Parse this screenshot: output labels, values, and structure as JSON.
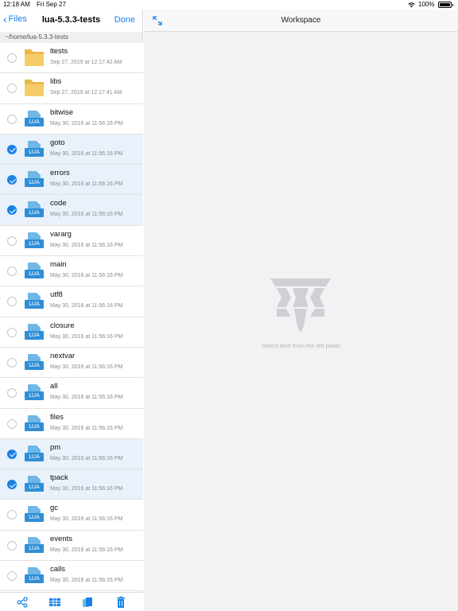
{
  "status": {
    "time": "12:18 AM",
    "date": "Fri Sep 27",
    "battery": "100%"
  },
  "left_nav": {
    "back_label": "Files",
    "title": "lua-5.3.3-tests",
    "done_label": "Done"
  },
  "path": "~/home/lua-5.3.3-tests",
  "files": [
    {
      "name": "ltests",
      "date": "Sep 27, 2019 at 12:17:42 AM",
      "type": "folder",
      "selected": false
    },
    {
      "name": "libs",
      "date": "Sep 27, 2019 at 12:17:41 AM",
      "type": "folder",
      "selected": false
    },
    {
      "name": "bitwise",
      "date": "May 30, 2016 at 11:56:16 PM",
      "type": "lua",
      "selected": false
    },
    {
      "name": "goto",
      "date": "May 30, 2016 at 11:56:16 PM",
      "type": "lua",
      "selected": true
    },
    {
      "name": "errors",
      "date": "May 30, 2016 at 11:56:16 PM",
      "type": "lua",
      "selected": true
    },
    {
      "name": "code",
      "date": "May 30, 2016 at 11:56:16 PM",
      "type": "lua",
      "selected": true
    },
    {
      "name": "vararg",
      "date": "May 30, 2016 at 11:56:16 PM",
      "type": "lua",
      "selected": false
    },
    {
      "name": "main",
      "date": "May 30, 2016 at 11:56:16 PM",
      "type": "lua",
      "selected": false
    },
    {
      "name": "utf8",
      "date": "May 30, 2016 at 11:56:16 PM",
      "type": "lua",
      "selected": false
    },
    {
      "name": "closure",
      "date": "May 30, 2016 at 11:56:16 PM",
      "type": "lua",
      "selected": false
    },
    {
      "name": "nextvar",
      "date": "May 30, 2016 at 11:56:16 PM",
      "type": "lua",
      "selected": false
    },
    {
      "name": "all",
      "date": "May 30, 2016 at 11:56:16 PM",
      "type": "lua",
      "selected": false
    },
    {
      "name": "files",
      "date": "May 30, 2016 at 11:56:16 PM",
      "type": "lua",
      "selected": false
    },
    {
      "name": "pm",
      "date": "May 30, 2016 at 11:56:16 PM",
      "type": "lua",
      "selected": true
    },
    {
      "name": "tpack",
      "date": "May 30, 2016 at 11:56:16 PM",
      "type": "lua",
      "selected": true
    },
    {
      "name": "gc",
      "date": "May 30, 2016 at 11:56:16 PM",
      "type": "lua",
      "selected": false
    },
    {
      "name": "events",
      "date": "May 30, 2016 at 11:56:16 PM",
      "type": "lua",
      "selected": false
    },
    {
      "name": "calls",
      "date": "May 30, 2016 at 11:56:16 PM",
      "type": "lua",
      "selected": false
    }
  ],
  "file_icon_label": "LUA",
  "toolbar": {
    "icons": [
      "share-icon",
      "columns-icon",
      "copy-icon",
      "trash-icon"
    ]
  },
  "workspace": {
    "title": "Workspace",
    "empty_message": "Select item from the left panel"
  },
  "colors": {
    "accent": "#1a82e6",
    "selected_row": "#e9f1fb",
    "folder": "#f6cc68",
    "lua_icon": "#2e8fd6"
  }
}
